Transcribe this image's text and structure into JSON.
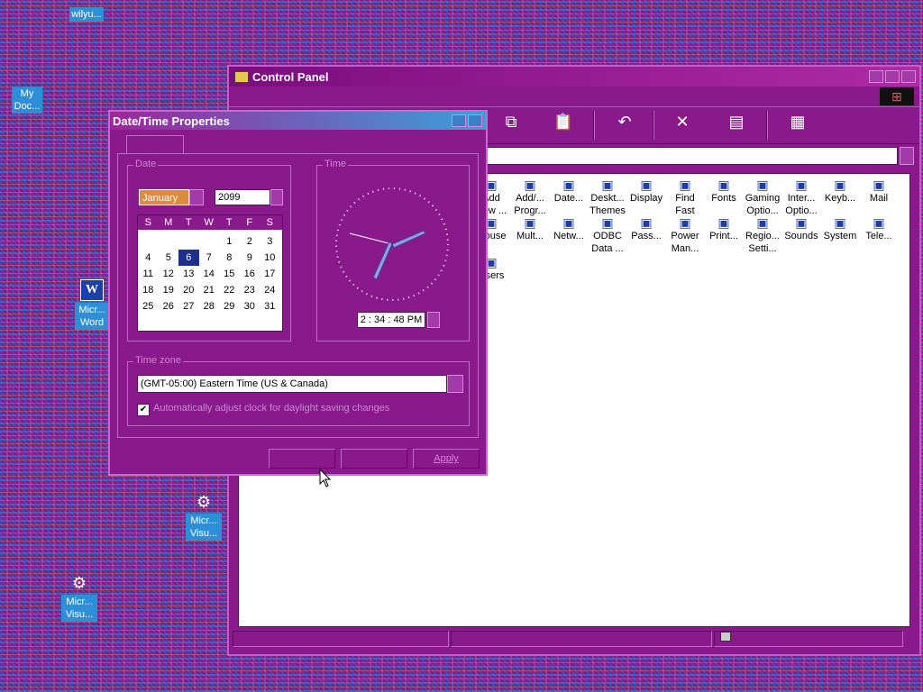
{
  "desktop": {
    "icons": [
      {
        "name": "wilyu-icon",
        "label": "wilyu..."
      },
      {
        "name": "my-documents-icon",
        "label": "My Doc..."
      },
      {
        "name": "microsoft-word-icon",
        "label": "Micr... Word"
      },
      {
        "name": "microsoft-visual-icon-1",
        "label": "Micr... Visu..."
      },
      {
        "name": "microsoft-visual-icon-2",
        "label": "Micr... Visu..."
      }
    ]
  },
  "control_panel": {
    "title": "Control Panel",
    "items": [
      {
        "label": "Add New ...",
        "icon": "add-hardware-icon"
      },
      {
        "label": "Add/... Progr...",
        "icon": "add-remove-programs-icon"
      },
      {
        "label": "Date...",
        "icon": "date-time-icon"
      },
      {
        "label": "Deskt... Themes",
        "icon": "desktop-themes-icon"
      },
      {
        "label": "Display",
        "icon": "display-icon"
      },
      {
        "label": "Find Fast",
        "icon": "find-fast-icon"
      },
      {
        "label": "Fonts",
        "icon": "fonts-icon"
      },
      {
        "label": "Gaming Optio...",
        "icon": "gaming-options-icon"
      },
      {
        "label": "Inter... Optio...",
        "icon": "internet-options-icon"
      },
      {
        "label": "Keyb...",
        "icon": "keyboard-icon"
      },
      {
        "label": "Mail",
        "icon": "mail-icon"
      },
      {
        "label": "Mouse",
        "icon": "mouse-icon"
      },
      {
        "label": "Mult...",
        "icon": "multimedia-icon"
      },
      {
        "label": "Netw...",
        "icon": "network-icon"
      },
      {
        "label": "ODBC Data ...",
        "icon": "odbc-data-sources-icon"
      },
      {
        "label": "Pass...",
        "icon": "passwords-icon"
      },
      {
        "label": "Power Man...",
        "icon": "power-management-icon"
      },
      {
        "label": "Print...",
        "icon": "printers-icon"
      },
      {
        "label": "Regio... Setti...",
        "icon": "regional-settings-icon"
      },
      {
        "label": "Sounds",
        "icon": "sounds-icon"
      },
      {
        "label": "System",
        "icon": "system-icon"
      },
      {
        "label": "Tele...",
        "icon": "telephony-icon"
      },
      {
        "label": "Users",
        "icon": "users-icon"
      }
    ]
  },
  "datetime": {
    "title": "Date/Time Properties",
    "date_group": "Date",
    "month": "January",
    "year": "2099",
    "weekdays": [
      "S",
      "M",
      "T",
      "W",
      "T",
      "F",
      "S"
    ],
    "weeks": [
      [
        "",
        "",
        "",
        "",
        "1",
        "2",
        "3"
      ],
      [
        "4",
        "5",
        "6",
        "7",
        "8",
        "9",
        "10"
      ],
      [
        "11",
        "12",
        "13",
        "14",
        "15",
        "16",
        "17"
      ],
      [
        "18",
        "19",
        "20",
        "21",
        "22",
        "23",
        "24"
      ],
      [
        "25",
        "26",
        "27",
        "28",
        "29",
        "30",
        "31"
      ]
    ],
    "selected_day": "6",
    "time_group": "Time",
    "time": "2 : 34 : 48 PM",
    "timezone_group": "Time zone",
    "timezone": "(GMT-05:00) Eastern Time (US & Canada)",
    "dst_checked": true,
    "dst_label": "Automatically adjust clock for daylight saving changes",
    "apply_label": "Apply"
  }
}
